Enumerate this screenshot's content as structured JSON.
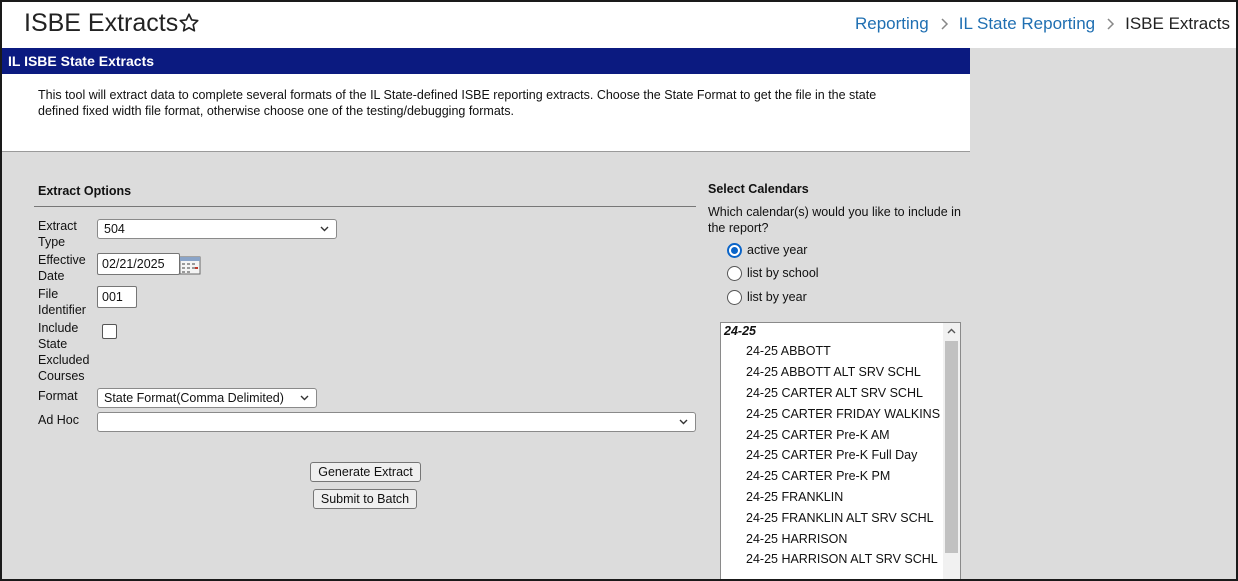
{
  "header": {
    "title": "ISBE Extracts",
    "breadcrumb": [
      "Reporting",
      "IL State Reporting",
      "ISBE Extracts"
    ]
  },
  "panel": {
    "title": "IL ISBE State Extracts",
    "description": "This tool will extract data to complete several formats of the IL State-defined ISBE reporting extracts. Choose the State Format to get the file in the state defined fixed width file format, otherwise choose one of the testing/debugging formats."
  },
  "extract_options": {
    "heading": "Extract Options",
    "extract_type_label": "Extract Type",
    "extract_type_value": "504",
    "effective_date_label": "Effective Date",
    "effective_date_value": "02/21/2025",
    "file_identifier_label": "File Identifier",
    "file_identifier_value": "001",
    "include_excluded_label": "Include State Excluded Courses",
    "format_label": "Format",
    "format_value": "State Format(Comma Delimited)",
    "ad_hoc_label": "Ad Hoc",
    "ad_hoc_value": "",
    "generate_label": "Generate Extract",
    "batch_label": "Submit to Batch"
  },
  "calendars": {
    "heading": "Select Calendars",
    "question": "Which calendar(s) would you like to include in the report?",
    "radios": [
      {
        "label": "active year",
        "selected": true
      },
      {
        "label": "list by school",
        "selected": false
      },
      {
        "label": "list by year",
        "selected": false
      }
    ],
    "group_label": "24-25",
    "options": [
      "24-25 ABBOTT",
      "24-25 ABBOTT ALT SRV SCHL",
      "24-25 CARTER ALT SRV SCHL",
      "24-25 CARTER FRIDAY WALKINS",
      "24-25 CARTER Pre-K AM",
      "24-25 CARTER Pre-K Full Day",
      "24-25 CARTER Pre-K PM",
      "24-25 FRANKLIN",
      "24-25 FRANKLIN ALT SRV SCHL",
      "24-25 HARRISON",
      "24-25 HARRISON ALT SRV SCHL"
    ]
  },
  "colors": {
    "panel_header_bg": "#0b1a80",
    "link": "#1f6fb2",
    "workspace_bg": "#dcdcdc",
    "radio_accent": "#0a64c8"
  }
}
